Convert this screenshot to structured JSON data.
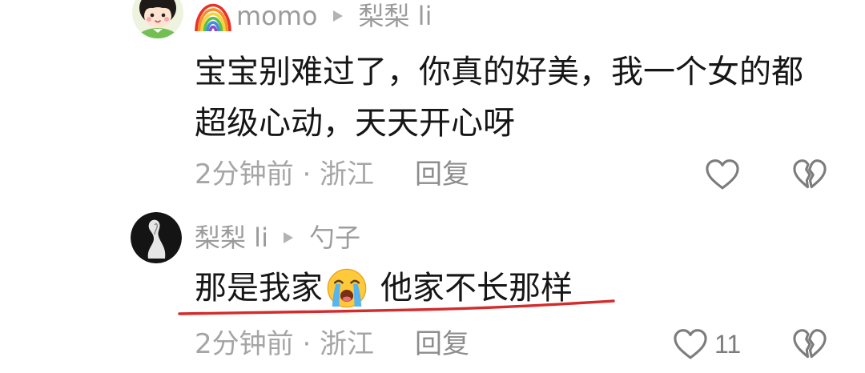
{
  "colors": {
    "background": "#ffffff",
    "text_primary": "#161616",
    "text_secondary": "#9b9b9b",
    "meta_text": "#a5a5a5",
    "reply_text": "#8d8d8d",
    "icon": "#7c7c7c",
    "underline": "#d42b2b"
  },
  "comments": [
    {
      "avatar_icon": "cartoon-avatar-icon",
      "username_badge_icon": "rainbow-icon",
      "username": "momo",
      "reply_arrow_icon": "reply-arrow-icon",
      "reply_to": "梨梨 li",
      "text_lines": [
        "宝宝别难过了，你真的好美，我一个女的都",
        "超级心动，天天开心呀"
      ],
      "meta": "2分钟前 · 浙江",
      "reply_label": "回复",
      "like_icon": "heart-outline-icon",
      "dislike_icon": "broken-heart-icon"
    },
    {
      "avatar_icon": "silhouette-avatar-icon",
      "username": "梨梨 li",
      "reply_arrow_icon": "reply-arrow-icon",
      "reply_to": "勺子",
      "text_before_emoji": "那是我家",
      "emoji_icon": "loudly-crying-face-icon",
      "text_after_emoji": "他家不长那样",
      "meta": "2分钟前 · 浙江",
      "reply_label": "回复",
      "like_icon": "heart-outline-icon",
      "like_count": "11",
      "dislike_icon": "broken-heart-icon"
    }
  ]
}
